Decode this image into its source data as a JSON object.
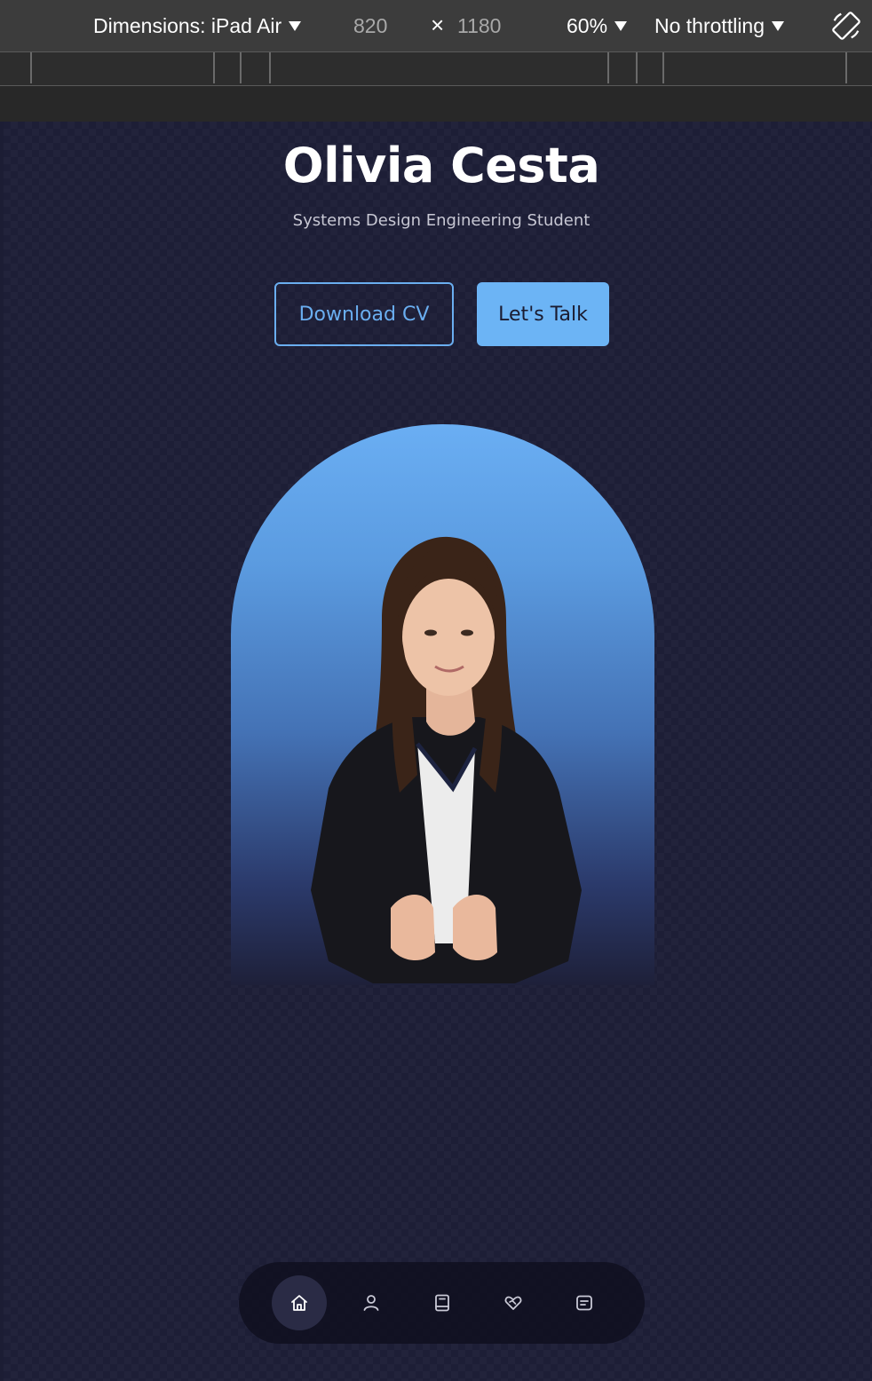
{
  "devtools": {
    "dimensions_label": "Dimensions: iPad Air",
    "width_value": "820",
    "times_glyph": "×",
    "height_value": "1180",
    "zoom": "60%",
    "throttling": "No throttling",
    "rotate_icon": "rotate-device-icon"
  },
  "hero": {
    "name": "Olivia Cesta",
    "subtitle": "Systems Design Engineering Student",
    "download_cv_label": "Download CV",
    "lets_talk_label": "Let's Talk"
  },
  "portrait": {
    "icon": "portrait-photo"
  },
  "nav": {
    "items": [
      {
        "icon": "home-icon",
        "active": true
      },
      {
        "icon": "user-icon",
        "active": false
      },
      {
        "icon": "book-icon",
        "active": false
      },
      {
        "icon": "handshake-heart-icon",
        "active": false
      },
      {
        "icon": "message-icon",
        "active": false
      }
    ]
  },
  "colors": {
    "page_bg": "#1d1e36",
    "accent": "#6cb4f5",
    "devtools_bg": "#3c3c3c"
  }
}
